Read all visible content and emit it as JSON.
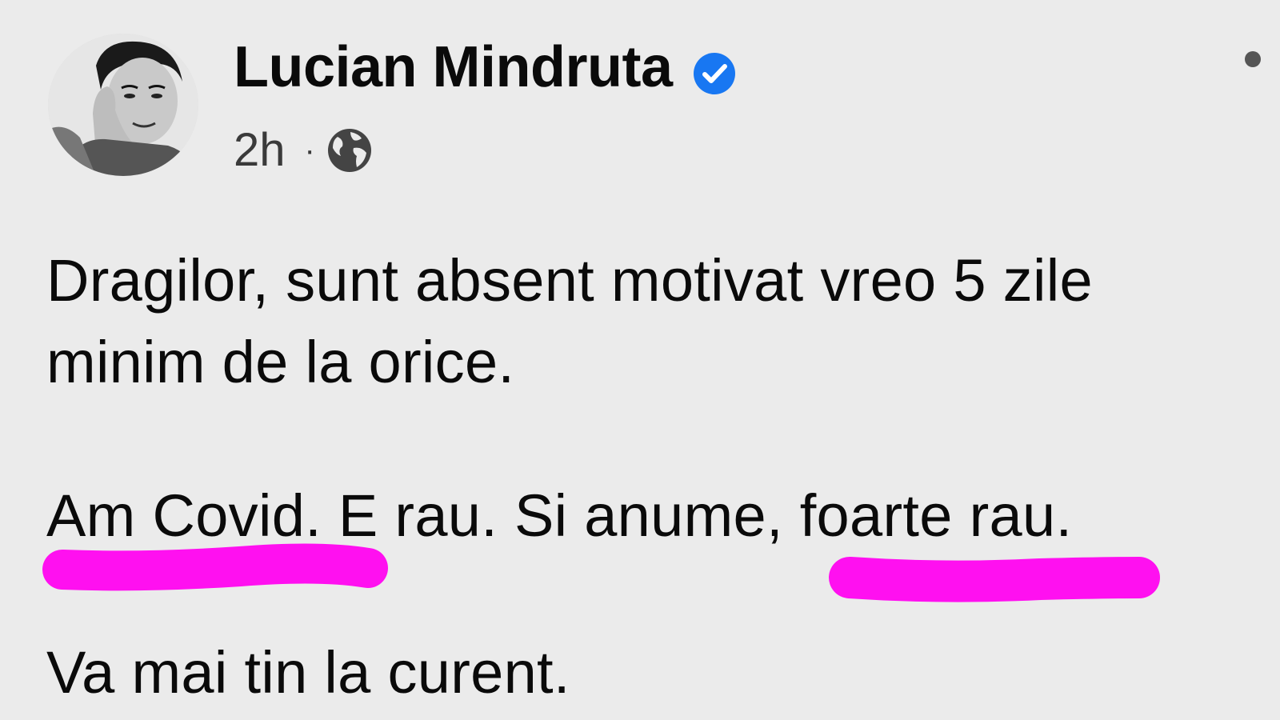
{
  "post": {
    "author": {
      "name": "Lucian Mindruta",
      "verified": true
    },
    "timestamp": "2h",
    "separator": "·",
    "audience_icon": "globe-icon",
    "more_icon": "more-options-icon",
    "body": {
      "paragraphs": [
        {
          "lines": [
            "Dragilor, sunt absent motivat vreo 5 zile",
            "minim de la orice."
          ]
        },
        {
          "lines": [
            "Am Covid. E rau. Si anume, foarte rau."
          ]
        },
        {
          "lines": [
            "Va mai tin la curent."
          ]
        }
      ]
    },
    "annotations": {
      "color": "#ff10f0",
      "underlined_phrases": [
        "Am Covid.",
        "foarte rau."
      ]
    }
  },
  "colors": {
    "background": "#ebebeb",
    "verified_badge": "#1877f2",
    "text": "#0a0a0a",
    "meta_text": "#3a3a3a"
  }
}
